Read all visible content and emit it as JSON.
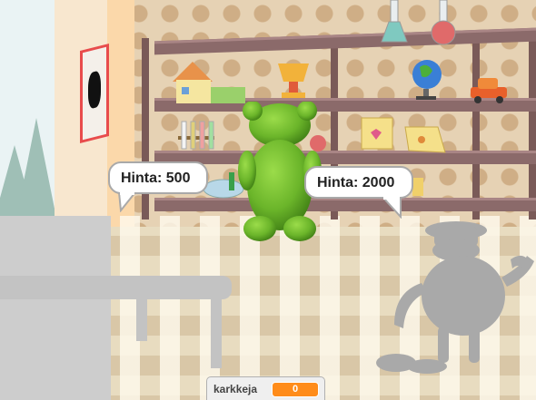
{
  "scene": {
    "name": "candy-shop"
  },
  "sprites": {
    "gummy_bear_price_bubble": {
      "text": "Hinta: 500"
    },
    "shopkeeper_price_bubble": {
      "text": "Hinta: 2000"
    }
  },
  "variable_monitor": {
    "label": "karkkeja",
    "value": "0",
    "color": "#ff8c1a"
  },
  "colors": {
    "gummy_bear": "#6bb52a",
    "shelf": "#7a5a58",
    "shopkeeper_silhouette": "#a9a9a9",
    "counter": "#cdcdcd"
  },
  "icons": [
    "house-icon",
    "trophy-icon",
    "globe-icon",
    "toy-car-icon",
    "flask-icon",
    "test-tubes-icon",
    "cards-icon",
    "candy-bowl-icon"
  ]
}
